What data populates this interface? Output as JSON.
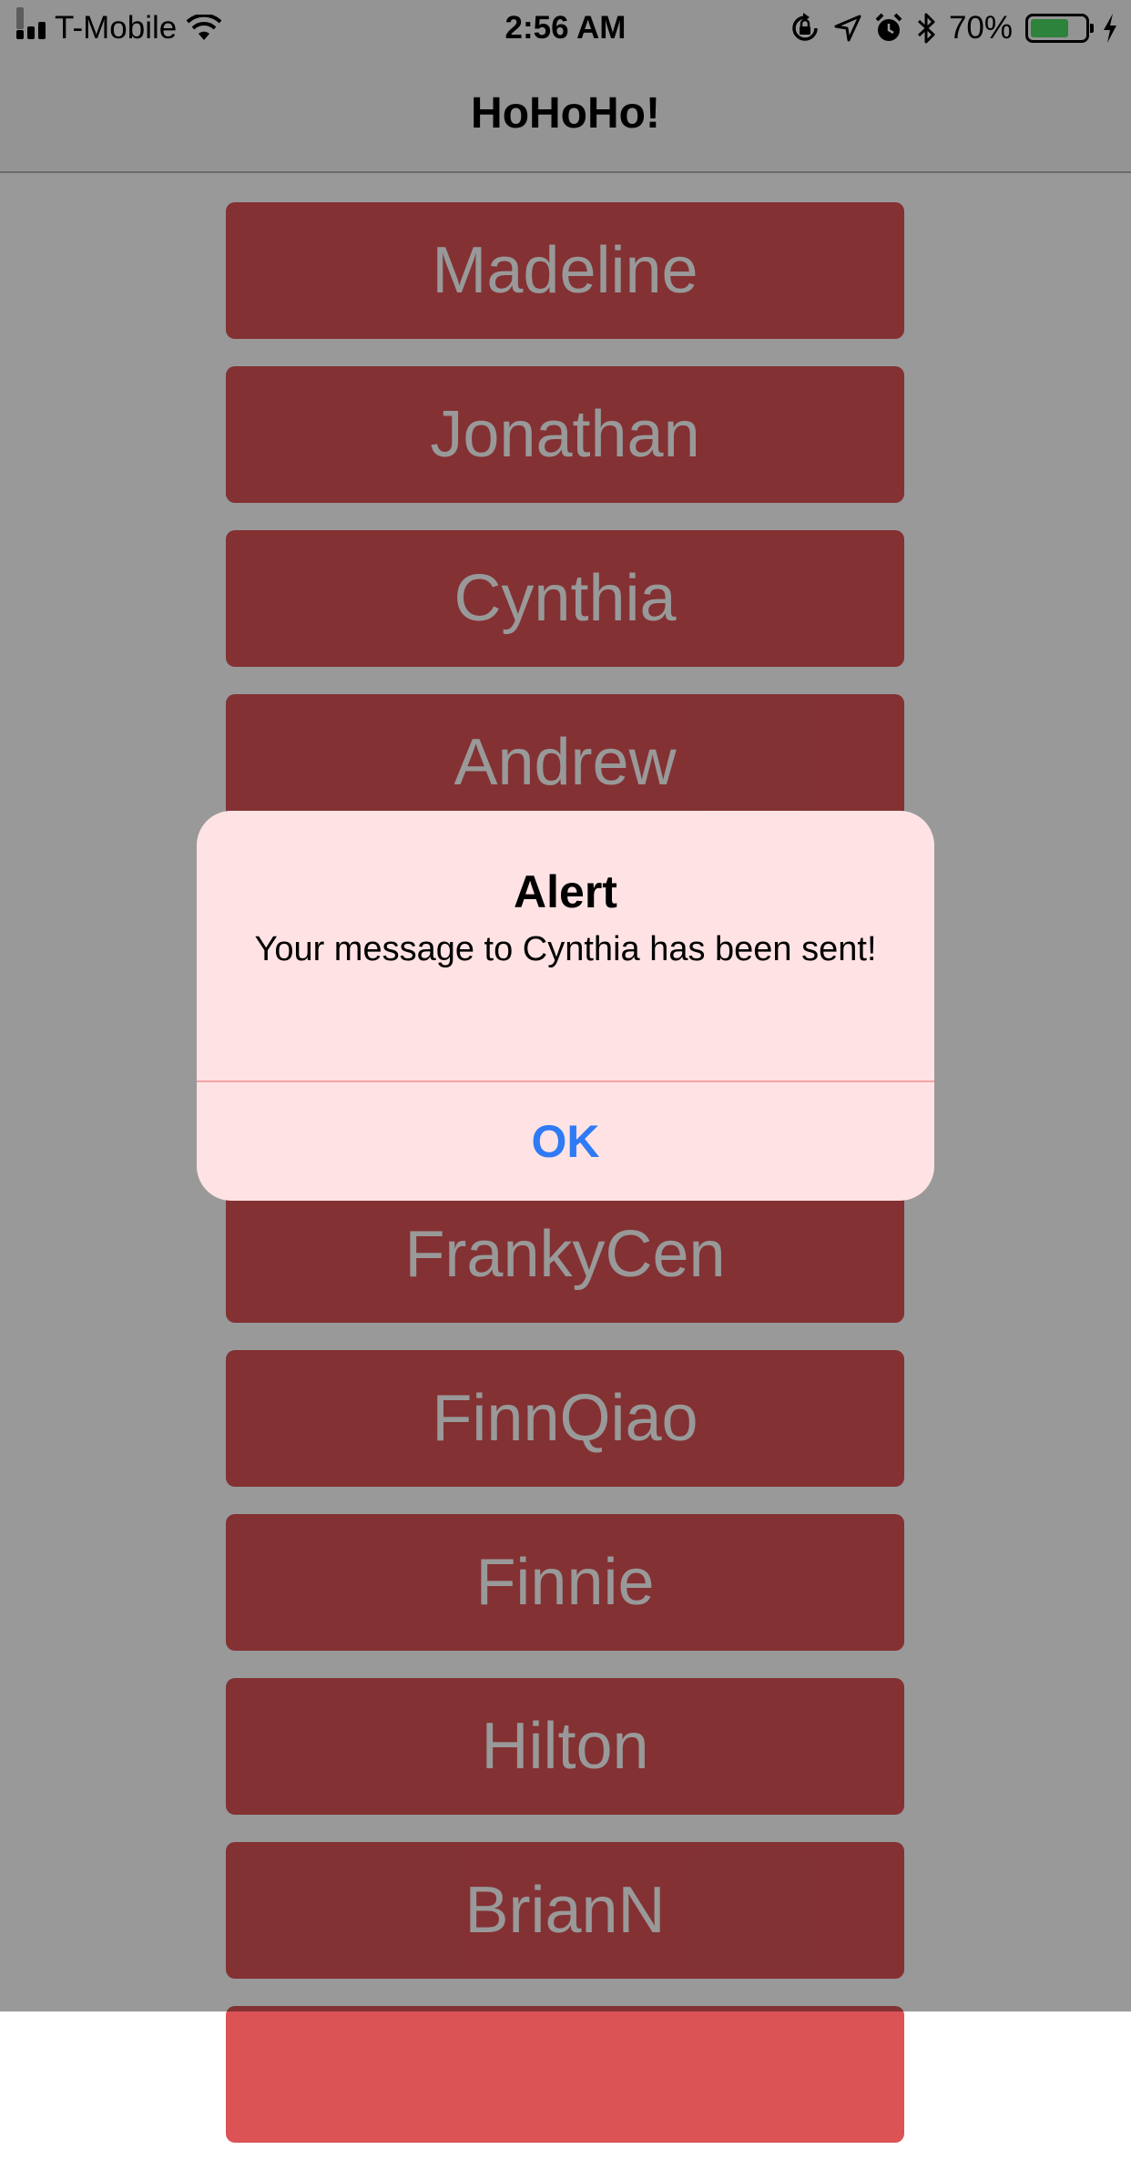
{
  "status_bar": {
    "carrier": "T-Mobile",
    "time": "2:56 AM",
    "battery_percent": "70%",
    "battery_level": 0.7,
    "icons": [
      "signal-icon",
      "wifi-icon",
      "orientation-lock-icon",
      "location-icon",
      "alarm-icon",
      "bluetooth-icon",
      "battery-icon",
      "charging-icon"
    ]
  },
  "nav": {
    "title": "HoHoHo!"
  },
  "people": [
    {
      "name": "Madeline"
    },
    {
      "name": "Jonathan"
    },
    {
      "name": "Cynthia"
    },
    {
      "name": "Andrew"
    },
    {
      "name": ""
    },
    {
      "name": ""
    },
    {
      "name": "FrankyCen"
    },
    {
      "name": "FinnQiao"
    },
    {
      "name": "Finnie"
    },
    {
      "name": "Hilton"
    },
    {
      "name": "BrianN"
    },
    {
      "name": ""
    }
  ],
  "alert": {
    "title": "Alert",
    "message": "Your message to Cynthia has been sent!",
    "ok_label": "OK"
  },
  "colors": {
    "button_red": "#db5355",
    "alert_background": "#ffe3e4",
    "ok_blue": "#2f7af5"
  }
}
